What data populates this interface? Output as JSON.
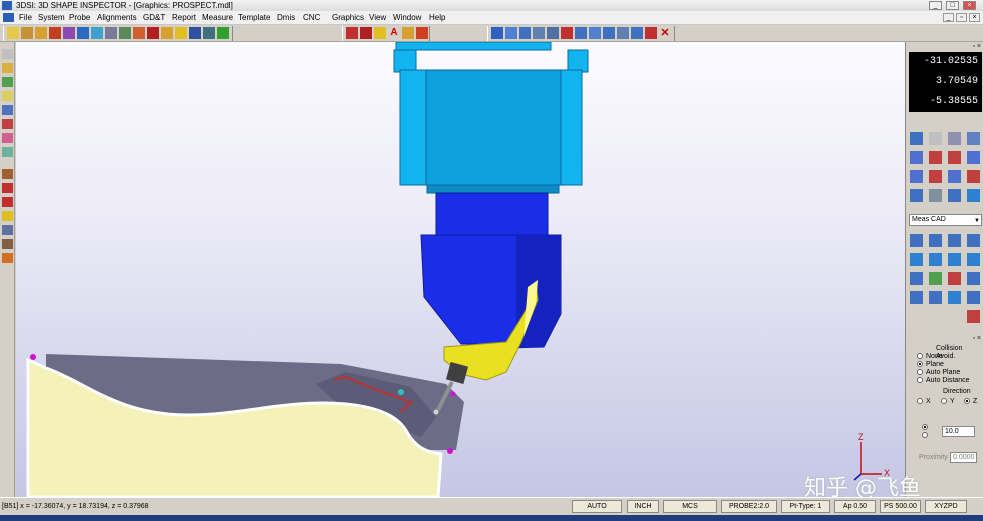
{
  "app": {
    "title": "3DSI: 3D SHAPE INSPECTOR - [Graphics: PROSPECT.mdl]",
    "window_buttons": [
      "_",
      "□",
      "×"
    ],
    "doc_window_buttons": [
      "_",
      "▫",
      "×"
    ]
  },
  "menu": [
    "File",
    "System",
    "Probe",
    "Alignments",
    "GD&T",
    "Report",
    "Measure",
    "Template",
    "Dmis",
    "CNC",
    "Graphics",
    "View",
    "Window",
    "Help"
  ],
  "readout": {
    "x": "-31.02535",
    "y": "3.70549",
    "z": "-5.38555"
  },
  "meas_dropdown": {
    "selected": "Meas CAD",
    "arrow": "▼"
  },
  "panel_close": "▫ ×",
  "collision": {
    "title": "Collision Avoid.",
    "options": [
      "None",
      "Plane",
      "Auto Plane",
      "Auto Distance"
    ],
    "selected": "Plane",
    "direction_title": "Direction",
    "directions": [
      "X",
      "Y",
      "Z"
    ],
    "direction_selected": "Z",
    "value": "10.0",
    "proximity_label": "Proximity",
    "proximity_value": "0.0000"
  },
  "status": {
    "coords": "[B51] x = -17.36074, y = 18.73194, z = 0.37968",
    "fields": [
      "AUTO",
      "INCH",
      "MCS",
      "PROBE2:2.0",
      "Pt-Type: 1",
      "Ap 0.50",
      "PS 500.00",
      "XYZPD"
    ]
  },
  "axes": {
    "z": "Z",
    "x": "X"
  },
  "watermark": "知乎 @飞鱼",
  "colors": {
    "spindle_light": "#11b4ee",
    "spindle_dark": "#1a2ee8",
    "probe_yellow": "#e8e020",
    "part_fill": "#f4f2b8",
    "surface_gray": "#6c6c86",
    "readout_bg": "#000000"
  }
}
